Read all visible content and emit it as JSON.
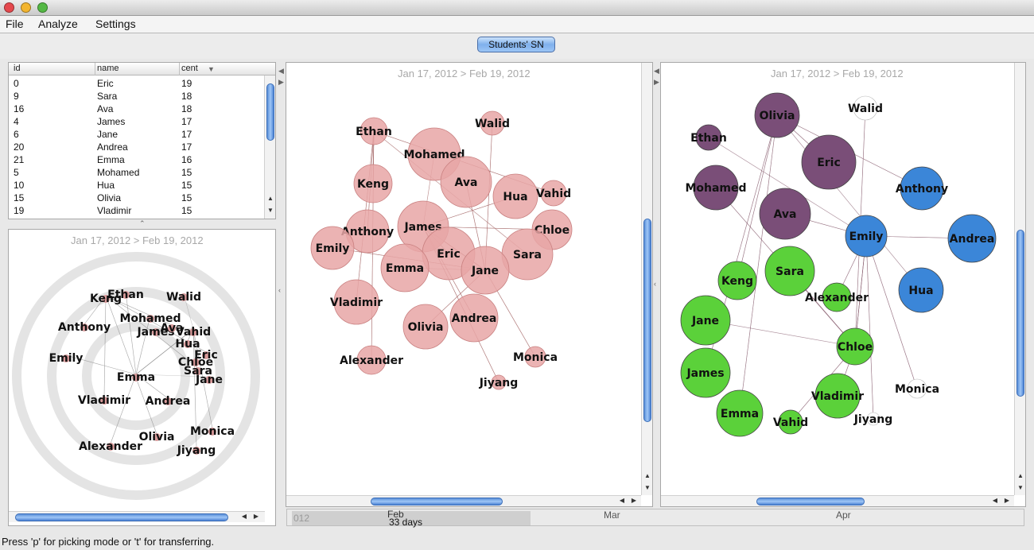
{
  "window": {
    "buttons": [
      "close",
      "minimize",
      "zoom"
    ]
  },
  "menu": {
    "items": [
      "File",
      "Analyze",
      "Settings"
    ]
  },
  "toolbar": {
    "tab_label": "Students' SN"
  },
  "table": {
    "columns": [
      "id",
      "name",
      "cent"
    ],
    "sort_indicator": "▼",
    "rows": [
      {
        "id": "0",
        "name": "Eric",
        "cent": "19"
      },
      {
        "id": "9",
        "name": "Sara",
        "cent": "18"
      },
      {
        "id": "16",
        "name": "Ava",
        "cent": "18"
      },
      {
        "id": "4",
        "name": "James",
        "cent": "17"
      },
      {
        "id": "6",
        "name": "Jane",
        "cent": "17"
      },
      {
        "id": "20",
        "name": "Andrea",
        "cent": "17"
      },
      {
        "id": "21",
        "name": "Emma",
        "cent": "16"
      },
      {
        "id": "5",
        "name": "Mohamed",
        "cent": "15"
      },
      {
        "id": "10",
        "name": "Hua",
        "cent": "15"
      },
      {
        "id": "15",
        "name": "Olivia",
        "cent": "15"
      },
      {
        "id": "19",
        "name": "Vladimir",
        "cent": "15"
      }
    ]
  },
  "radial_view": {
    "date_range": "Jan 17, 2012 > Feb 19, 2012",
    "nodes": [
      {
        "name": "Keng"
      },
      {
        "name": "Ethan"
      },
      {
        "name": "Walid"
      },
      {
        "name": "Anthony"
      },
      {
        "name": "Mohamed"
      },
      {
        "name": "James"
      },
      {
        "name": "Ava"
      },
      {
        "name": "Vahid"
      },
      {
        "name": "Hua"
      },
      {
        "name": "Eric"
      },
      {
        "name": "Emily"
      },
      {
        "name": "Chloe"
      },
      {
        "name": "Sara"
      },
      {
        "name": "Jane"
      },
      {
        "name": "Emma"
      },
      {
        "name": "Vladimir"
      },
      {
        "name": "Andrea"
      },
      {
        "name": "Monica"
      },
      {
        "name": "Olivia"
      },
      {
        "name": "Alexander"
      },
      {
        "name": "Jiyang"
      }
    ]
  },
  "centrality_view": {
    "date_range": "Jan 17, 2012 > Feb 19, 2012",
    "node_color": "#e8a6a6",
    "node_stroke": "#c98080",
    "nodes": [
      {
        "name": "Ethan"
      },
      {
        "name": "Walid"
      },
      {
        "name": "Mohamed"
      },
      {
        "name": "Keng"
      },
      {
        "name": "Ava"
      },
      {
        "name": "Hua"
      },
      {
        "name": "Vahid"
      },
      {
        "name": "James"
      },
      {
        "name": "Chloe"
      },
      {
        "name": "Anthony"
      },
      {
        "name": "Emily"
      },
      {
        "name": "Eric"
      },
      {
        "name": "Sara"
      },
      {
        "name": "Emma"
      },
      {
        "name": "Jane"
      },
      {
        "name": "Vladimir"
      },
      {
        "name": "Olivia"
      },
      {
        "name": "Andrea"
      },
      {
        "name": "Alexander"
      },
      {
        "name": "Monica"
      },
      {
        "name": "Jiyang"
      }
    ]
  },
  "community_view": {
    "date_range": "Jan 17, 2012 > Feb 19, 2012",
    "colors": {
      "purple": "#7a4e78",
      "blue": "#3b86d8",
      "green": "#5bd13a"
    },
    "nodes": [
      {
        "name": "Olivia",
        "group": "purple"
      },
      {
        "name": "Walid",
        "group": "none"
      },
      {
        "name": "Ethan",
        "group": "purple"
      },
      {
        "name": "Eric",
        "group": "purple"
      },
      {
        "name": "Mohamed",
        "group": "purple"
      },
      {
        "name": "Ava",
        "group": "purple"
      },
      {
        "name": "Anthony",
        "group": "blue"
      },
      {
        "name": "Emily",
        "group": "blue"
      },
      {
        "name": "Andrea",
        "group": "blue"
      },
      {
        "name": "Keng",
        "group": "green"
      },
      {
        "name": "Sara",
        "group": "green"
      },
      {
        "name": "Alexander",
        "group": "green"
      },
      {
        "name": "Hua",
        "group": "blue"
      },
      {
        "name": "Jane",
        "group": "green"
      },
      {
        "name": "Chloe",
        "group": "green"
      },
      {
        "name": "James",
        "group": "green"
      },
      {
        "name": "Vladimir",
        "group": "green"
      },
      {
        "name": "Monica",
        "group": "none"
      },
      {
        "name": "Emma",
        "group": "green"
      },
      {
        "name": "Vahid",
        "group": "green"
      },
      {
        "name": "Jiyang",
        "group": "none"
      }
    ]
  },
  "timeline": {
    "start_label": "012",
    "feb_label": "Feb",
    "span_label": "33 days",
    "mar_label": "Mar",
    "apr_label": "Apr"
  },
  "status": {
    "message": "Press 'p' for picking mode or 't' for transferring."
  }
}
